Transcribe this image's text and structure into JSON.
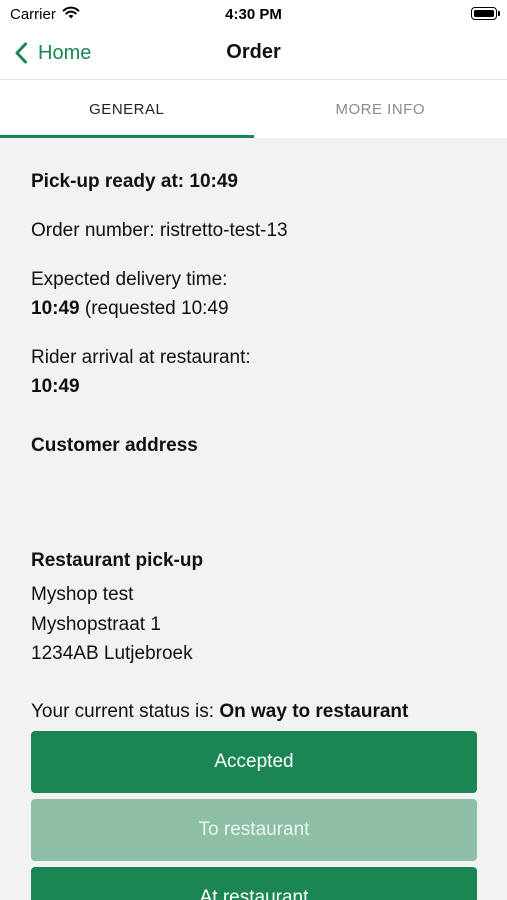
{
  "status_bar": {
    "carrier": "Carrier",
    "time": "4:30 PM"
  },
  "nav": {
    "back_label": "Home",
    "title": "Order"
  },
  "tabs": [
    {
      "label": "GENERAL"
    },
    {
      "label": "MORE INFO"
    }
  ],
  "order": {
    "pickup_label": "Pick-up ready at:",
    "pickup_time": "10:49",
    "order_number_label": "Order number:",
    "order_number": "ristretto-test-13",
    "expected_label": "Expected delivery time:",
    "expected_time": "10:49",
    "expected_requested": "(requested 10:49",
    "rider_label": "Rider arrival at restaurant:",
    "rider_time": "10:49",
    "customer_address_label": "Customer address",
    "restaurant_label": "Restaurant pick-up",
    "restaurant_name": "Myshop test",
    "restaurant_street": "Myshopstraat 1",
    "restaurant_city": "1234AB Lutjebroek",
    "status_prefix": "Your current status is:",
    "status_value": "On way to restaurant"
  },
  "actions": {
    "accepted": "Accepted",
    "to_restaurant": "To restaurant",
    "at_restaurant": "At restaurant"
  },
  "colors": {
    "accent": "#1b8553",
    "accent_disabled": "#8cbfa5",
    "background": "#f2f2f2"
  }
}
